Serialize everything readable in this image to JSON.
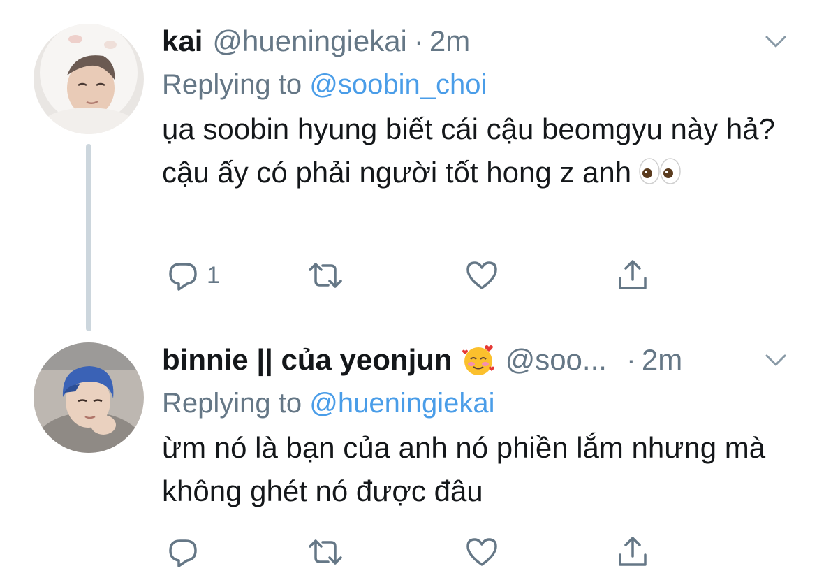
{
  "tweets": [
    {
      "display_name": "kai",
      "handle": "@hueningiekai",
      "separator": "·",
      "time": "2m",
      "replying_label": "Replying to",
      "replying_to": "@soobin_choi",
      "text": "ụa soobin hyung biết cái cậu beomgyu này hả? cậu ấy có phải người tốt hong z anh",
      "emoji": "eyes",
      "reply_count": "1",
      "avatar_desc": "person in white fluffy hood"
    },
    {
      "display_name": "binnie || của yeonjun",
      "display_emoji": "smiling-face-with-hearts",
      "handle": "@soo...",
      "separator": "·",
      "time": "2m",
      "replying_label": "Replying to",
      "replying_to": "@hueningiekai",
      "text": "ừm nó là bạn của anh nó phiền lắm nhưng mà không ghét nó được đâu",
      "reply_count": "",
      "avatar_desc": "person with blue hair"
    }
  ],
  "colors": {
    "link_blue": "#4a9de8",
    "muted_gray": "#657786",
    "thread_line": "#ccd6dd",
    "icon_gray": "#657786"
  },
  "icons": [
    "reply-icon",
    "retweet-icon",
    "like-icon",
    "share-icon",
    "chevron-down-icon"
  ]
}
